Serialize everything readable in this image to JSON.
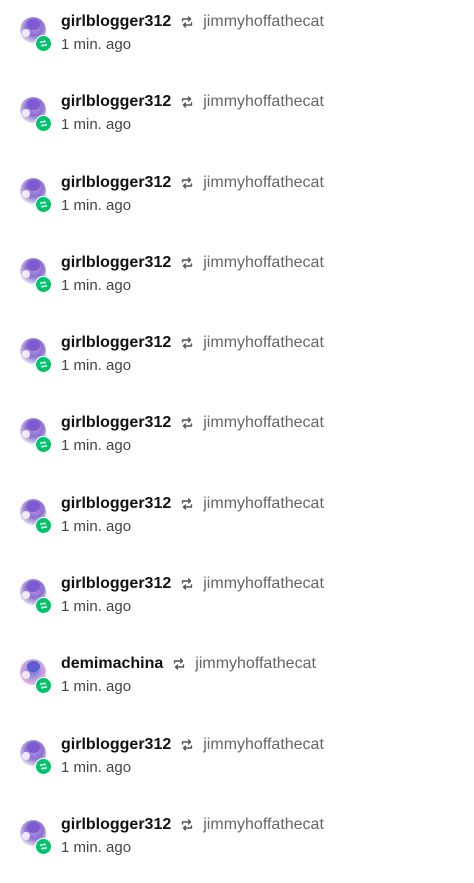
{
  "notes": [
    {
      "blog": "girlblogger312",
      "reblogged_from": "jimmyhoffathecat",
      "time": "1 min. ago",
      "avatar": "girlblogger312-avatar"
    },
    {
      "blog": "girlblogger312",
      "reblogged_from": "jimmyhoffathecat",
      "time": "1 min. ago",
      "avatar": "girlblogger312-avatar"
    },
    {
      "blog": "girlblogger312",
      "reblogged_from": "jimmyhoffathecat",
      "time": "1 min. ago",
      "avatar": "girlblogger312-avatar"
    },
    {
      "blog": "girlblogger312",
      "reblogged_from": "jimmyhoffathecat",
      "time": "1 min. ago",
      "avatar": "girlblogger312-avatar"
    },
    {
      "blog": "girlblogger312",
      "reblogged_from": "jimmyhoffathecat",
      "time": "1 min. ago",
      "avatar": "girlblogger312-avatar"
    },
    {
      "blog": "girlblogger312",
      "reblogged_from": "jimmyhoffathecat",
      "time": "1 min. ago",
      "avatar": "girlblogger312-avatar"
    },
    {
      "blog": "girlblogger312",
      "reblogged_from": "jimmyhoffathecat",
      "time": "1 min. ago",
      "avatar": "girlblogger312-avatar"
    },
    {
      "blog": "girlblogger312",
      "reblogged_from": "jimmyhoffathecat",
      "time": "1 min. ago",
      "avatar": "girlblogger312-avatar"
    },
    {
      "blog": "demimachina",
      "reblogged_from": "jimmyhoffathecat",
      "time": "1 min. ago",
      "avatar": "demimachina-avatar"
    },
    {
      "blog": "girlblogger312",
      "reblogged_from": "jimmyhoffathecat",
      "time": "1 min. ago",
      "avatar": "girlblogger312-avatar"
    },
    {
      "blog": "girlblogger312",
      "reblogged_from": "jimmyhoffathecat",
      "time": "1 min. ago",
      "avatar": "girlblogger312-avatar"
    }
  ],
  "icons": {
    "reblog_badge": "reblog-icon",
    "reblog_separator": "reblog-icon"
  },
  "colors": {
    "badge": "#00c46a",
    "username": "#111111",
    "source": "#666666",
    "time": "#444444"
  }
}
